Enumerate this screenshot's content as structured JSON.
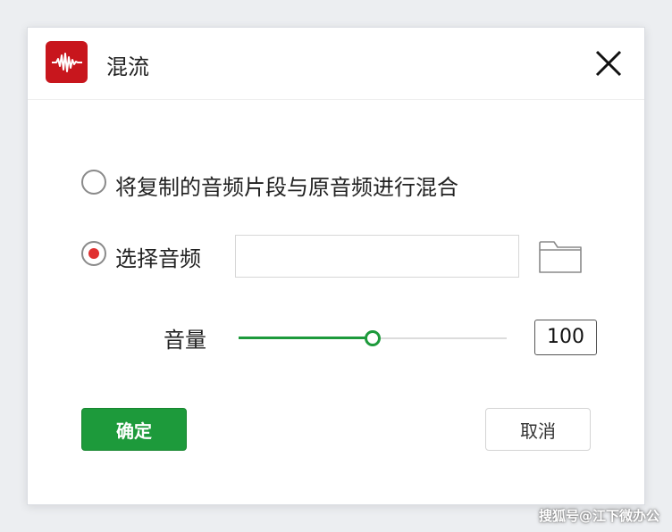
{
  "dialog": {
    "title": "混流",
    "app_icon": "audio-waveform-icon",
    "close_icon": "close-icon"
  },
  "options": {
    "mix_copied": {
      "label": "将复制的音频片段与原音频进行混合",
      "checked": false
    },
    "select_audio": {
      "label": "选择音频",
      "checked": true,
      "file_value": "",
      "folder_icon": "folder-icon"
    }
  },
  "volume": {
    "label": "音量",
    "value": "100",
    "slider_fraction": 0.5
  },
  "buttons": {
    "ok": "确定",
    "cancel": "取消"
  },
  "watermark": "搜狐号@江下微办公",
  "colors": {
    "accent": "#1d9a3b",
    "radio_selected": "#e03030",
    "app_icon_bg": "#c8161d"
  }
}
